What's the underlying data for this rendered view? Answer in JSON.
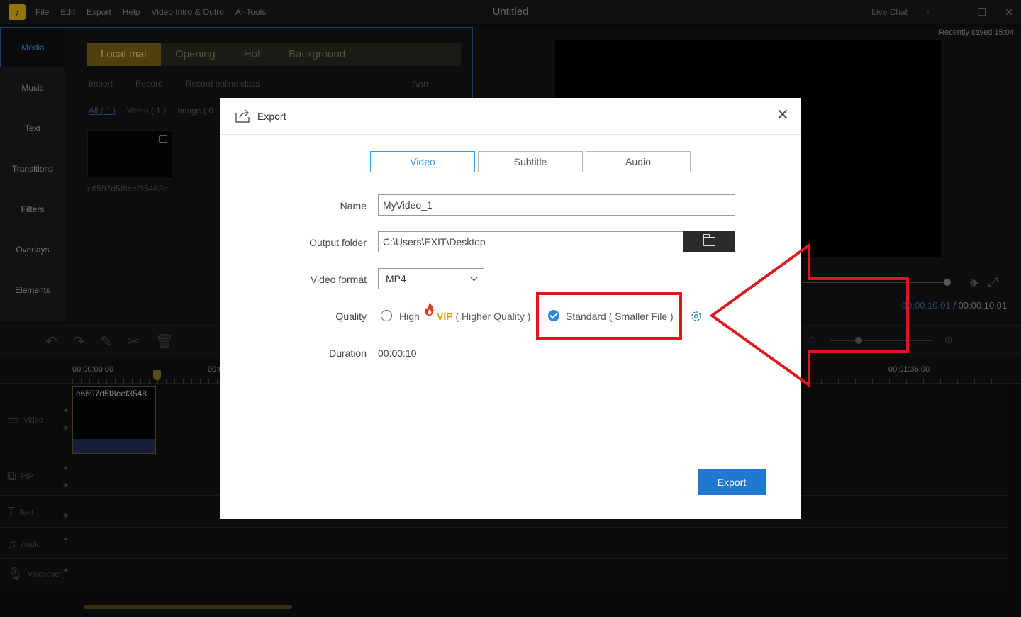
{
  "titlebar": {
    "menu": [
      "File",
      "Edit",
      "Export",
      "Help",
      "Video Intro & Outro",
      "AI-Tools"
    ],
    "title": "Untitled",
    "live_chat": "Live Chat"
  },
  "sidenav": {
    "items": [
      "Media",
      "Music",
      "Text",
      "Transitions",
      "Filters",
      "Overlays",
      "Elements"
    ]
  },
  "media": {
    "tabs": [
      "Local mat",
      "Opening",
      "Hot",
      "Background"
    ],
    "tools": [
      "Import",
      "Record",
      "Record online class"
    ],
    "sort": "Sort",
    "filters": [
      "All ( 1 )",
      "Video ( 1 )",
      "Image ( 0"
    ],
    "thumb_name": "e6597d5f8eef35482e..."
  },
  "preview": {
    "saved": "Recently saved 15:04",
    "time_current": "00:00:10.01",
    "time_separator": "/",
    "time_total": "00:00:10.01"
  },
  "timeline": {
    "ticks": [
      "00:00:00.00",
      "00:0",
      "00:01:36.00"
    ],
    "tracks": [
      "Video",
      "PIP",
      "Text",
      "Audio",
      "Voiceover"
    ],
    "clip_name": "e6597d5f8eef3548"
  },
  "dialog": {
    "title": "Export",
    "tabs": [
      "Video",
      "Subtitle",
      "Audio"
    ],
    "name_label": "Name",
    "name_value": "MyVideo_1",
    "folder_label": "Output folder",
    "folder_value": "C:\\Users\\EXIT\\Desktop",
    "format_label": "Video format",
    "format_value": "MP4",
    "quality_label": "Quality",
    "quality_high": "High",
    "quality_vip": "VIP",
    "quality_high_note": "( Higher Quality )",
    "quality_standard": "Standard ( Smaller File )",
    "quality_selected": "standard",
    "duration_label": "Duration",
    "duration_value": "00:00:10",
    "export_button": "Export"
  },
  "colors": {
    "accent": "#1f78d1",
    "highlight": "#e0161e",
    "gold": "#7a6516"
  }
}
